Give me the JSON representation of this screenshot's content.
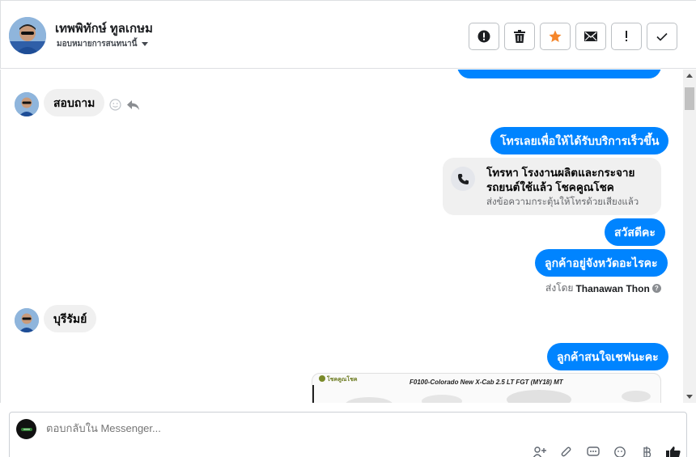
{
  "header": {
    "contact_name": "เทพพิทักษ์ ทูลเกษม",
    "assign_label": "มอบหมายการสนทนานี้",
    "toolbar": [
      {
        "icon": "alert-circle-icon"
      },
      {
        "icon": "trash-icon"
      },
      {
        "icon": "star-icon"
      },
      {
        "icon": "envelope-icon"
      },
      {
        "icon": "exclamation-icon"
      },
      {
        "icon": "check-icon"
      }
    ]
  },
  "messages": {
    "incoming_1": "สอบถาม",
    "outgoing_1": "โทรเลยเพื่อให้ได้รับบริการเร็วขึ้น",
    "call_card": {
      "title": "โทรหา โรงงานผลิตและกระจาย รถยนต์ใช้แล้ว โชคคูณโชค",
      "subtitle": "ส่งข้อความกระตุ้นให้โทรด้วยเสียงแล้ว"
    },
    "outgoing_2": "สวัสดีคะ",
    "outgoing_3": "ลูกค้าอยู่จังหวัดอะไรคะ",
    "sent_by_label": "ส่งโดย",
    "sent_by_name": "Thanawan Thon",
    "incoming_2": "บุรีรัมย์",
    "outgoing_4": "ลูกค้าสนใจเชฟนะคะ",
    "image_card": {
      "logo_text": "โชคคูณโชค",
      "title": "F0100-Colorado New X-Cab 2.5 LT FGT (MY18) MT"
    }
  },
  "composer": {
    "placeholder": "ตอบกลับใน Messenger..."
  },
  "colors": {
    "accent": "#0084ff",
    "incoming_bg": "#f0f0f0",
    "star": "#f5862b"
  }
}
